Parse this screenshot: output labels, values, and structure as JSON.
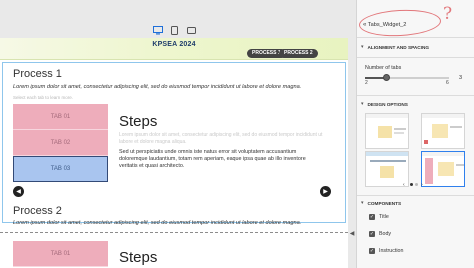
{
  "widget": {
    "name": "Tabs_Widget_2"
  },
  "canvas": {
    "header_title": "KPSEA 2024",
    "header_buttons": [
      "PROCESS 1",
      "PROCESS 2"
    ]
  },
  "process1": {
    "title": "Process 1",
    "text": "Lorem ipsum dolor sit amet, consectetur adipiscing elit, sed do eiusmod tempor incididunt ut labore et dolore magna.",
    "instruction": "Select each tab to learn more.",
    "tabs": [
      "TAB 01",
      "TAB 02",
      "TAB 03"
    ],
    "selected_tab": 2,
    "content_title": "Steps",
    "content_faded": "Lorem ipsum dolor sit amet, consectetur adipiscing elit, sed do eiusmod tempor incididunt ut labore et dolore magna aliqua.",
    "content_body": "Sed ut perspiciatis unde omnis iste natus error sit voluptatem accusantium doloremque laudantium, totam rem aperiam, eaque ipsa quae ab illo inventore veritatis et quasi architecto."
  },
  "process2": {
    "title": "Process 2",
    "text": "Lorem ipsum dolor sit amet, consectetur adipiscing elit, sed do eiusmod tempor incididunt ut labore et dolore magna.",
    "tabs": [
      "TAB 01"
    ],
    "content_title": "Steps"
  },
  "panel": {
    "alignment_heading": "ALIGNMENT AND SPACING",
    "num_tabs_label": "Number of tabs",
    "num_tabs_min": "2",
    "num_tabs_max": "6",
    "num_tabs_value": "3",
    "num_tabs_fraction": 0.25,
    "design_heading": "DESIGN OPTIONS",
    "design_pager": "1",
    "components_heading": "COMPONENTS",
    "components": [
      "Title",
      "Body",
      "Instruction"
    ]
  },
  "icons": [
    "desktop-icon",
    "tablet-icon",
    "mobile-icon",
    "double-chevron-left-icon",
    "chevron-left-icon",
    "chevron-right-icon",
    "checkbox-icon"
  ],
  "colors": {
    "tab": "#eeadbb",
    "tab_selected": "#a9c5ef",
    "selection": "#2f80ed",
    "annotation": "#e2777b"
  }
}
